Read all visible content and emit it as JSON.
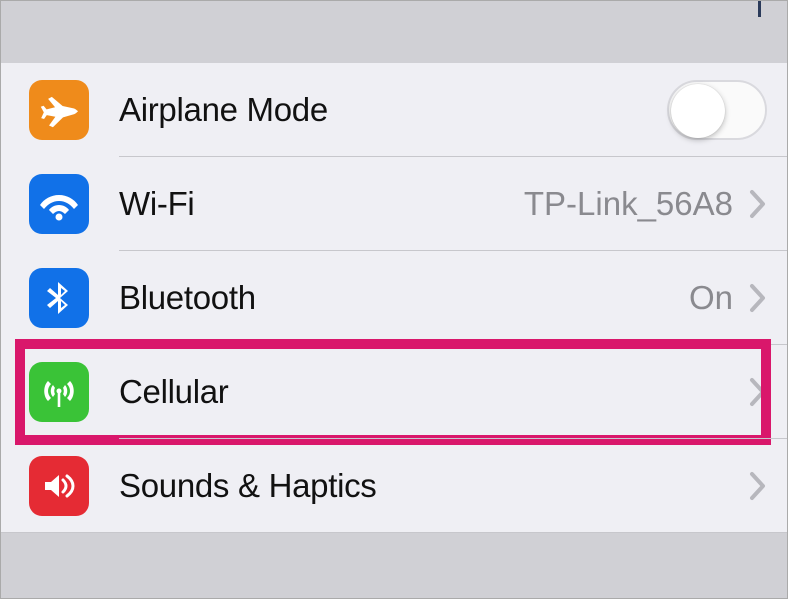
{
  "settings": {
    "airplane_mode": {
      "label": "Airplane Mode",
      "toggle_on": false
    },
    "wifi": {
      "label": "Wi-Fi",
      "value": "TP-Link_56A8"
    },
    "bluetooth": {
      "label": "Bluetooth",
      "value": "On"
    },
    "cellular": {
      "label": "Cellular",
      "highlighted": true
    },
    "sounds_haptics": {
      "label": "Sounds & Haptics"
    }
  },
  "colors": {
    "airplane": "#ef8b1b",
    "wifi": "#1171e8",
    "bluetooth": "#1171e8",
    "cellular": "#3ac337",
    "sounds": "#e52b34",
    "highlight": "#d9176b"
  }
}
